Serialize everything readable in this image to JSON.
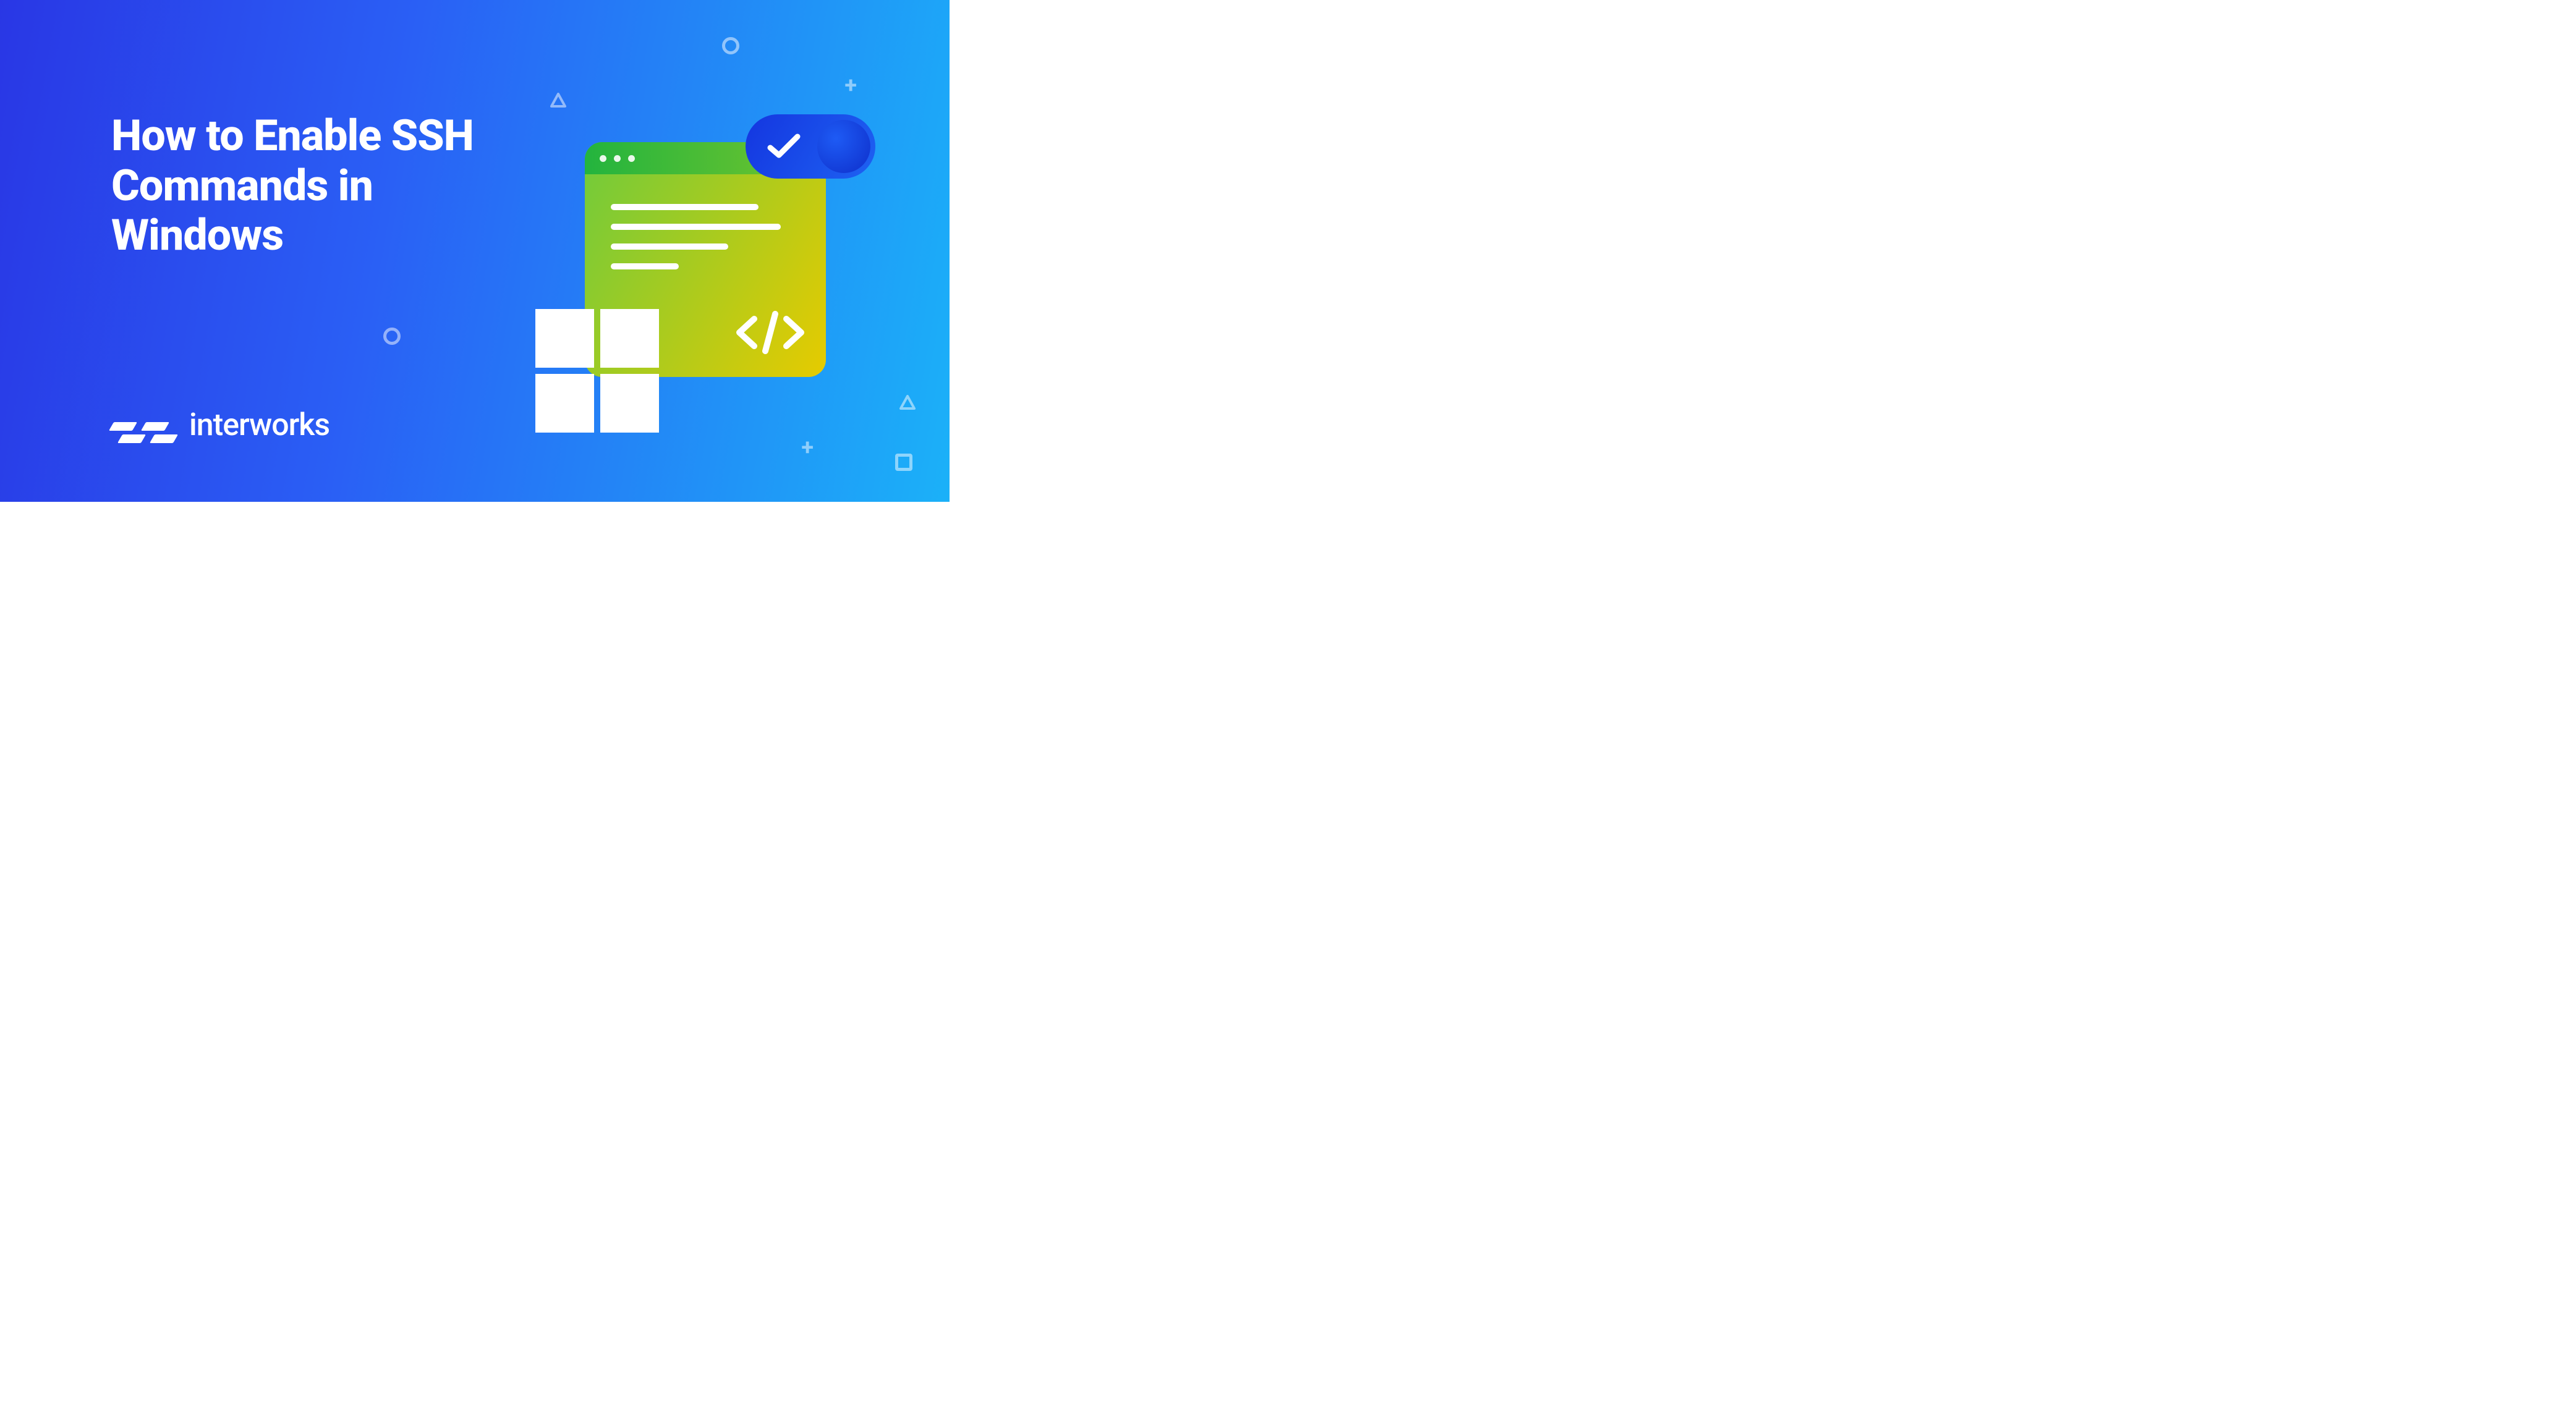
{
  "hero": {
    "headline": "How to Enable SSH Commands in Windows"
  },
  "brand": {
    "name": "interworks"
  }
}
